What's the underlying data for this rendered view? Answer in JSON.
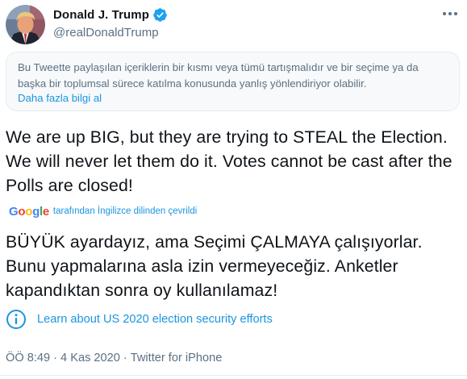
{
  "author": {
    "display_name": "Donald J. Trump",
    "handle": "@realDonaldTrump",
    "verified": true,
    "avatar_icon": "avatar-photo"
  },
  "notice": {
    "text": "Bu Tweette paylaşılan içeriklerin bir kısmı veya tümü tartışmalıdır ve bir seçime ya da başka bir toplumsal sürece katılma konusunda yanlış yönlendiriyor olabilir.",
    "link_label": "Daha fazla bilgi al"
  },
  "tweet": {
    "text": "We are up BIG, but they are trying to STEAL the Election. We will never let them do it. Votes cannot be cast after the Polls are closed!",
    "translation_provider": "Google",
    "translation_attribution": "tarafından İngilizce dilinden çevrildi",
    "translated_text": "BÜYÜK ayardayız, ama Seçimi ÇALMAYA çalışıyorlar. Bunu yapmalarına asla izin vermeyeceğiz. Anketler kapandıktan sonra oy kullanılamaz!"
  },
  "election_info": {
    "label": "Learn about US 2020 election security efforts",
    "icon": "info-icon"
  },
  "meta": {
    "time": "ÖÖ 8:49",
    "separator": "·",
    "date": "4 Kas 2020",
    "source": "Twitter for iPhone"
  },
  "colors": {
    "accent": "#1b95e0",
    "verified": "#1da1f2",
    "secondary_text": "#5b7083",
    "primary_text": "#0f1419",
    "notice_bg": "#f7f9fa",
    "border": "#e6ecf0"
  }
}
